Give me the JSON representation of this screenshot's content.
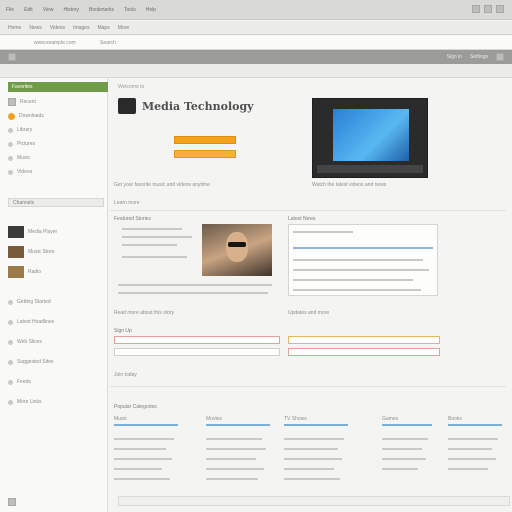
{
  "topbar": {
    "items": [
      "File",
      "Edit",
      "View",
      "History",
      "Bookmarks",
      "Tools",
      "Help"
    ]
  },
  "tabbar": {
    "items": [
      "Home",
      "News",
      "Videos",
      "Images",
      "Maps",
      "More"
    ]
  },
  "addrbar": {
    "url": "www.example.com",
    "search": "Search"
  },
  "toolbar2": {
    "items": [
      "Sign in",
      "Settings"
    ]
  },
  "sidebar": {
    "header": "Favorites",
    "rows": [
      "Recent",
      "Downloads",
      "Library",
      "Pictures",
      "Music",
      "Videos"
    ],
    "section1": "Channels",
    "channels": [
      "Media Player",
      "Music Store",
      "Radio"
    ],
    "section2": "Links",
    "links": [
      "Getting Started",
      "Latest Headlines",
      "Web Slices",
      "Suggested Sites",
      "Feeds",
      "More Links"
    ]
  },
  "main": {
    "hero_label": "Welcome to",
    "hero_title": "Media Technology",
    "shot_caption": "Watch the latest videos and news",
    "caption_left": "Get your favorite music and videos anytime",
    "caption_left2": "Learn more",
    "news_title": "Featured Stories",
    "news_caption": "Read more about this story",
    "right_box_title": "Latest News",
    "right_box_caption": "Updates and more",
    "form_title": "Sign Up",
    "form_caption": "Join today",
    "bottom_title": "Popular Categories",
    "col1": "Music",
    "col2": "Movies",
    "col3": "TV Shows",
    "col4": "Games",
    "col5": "Books"
  }
}
